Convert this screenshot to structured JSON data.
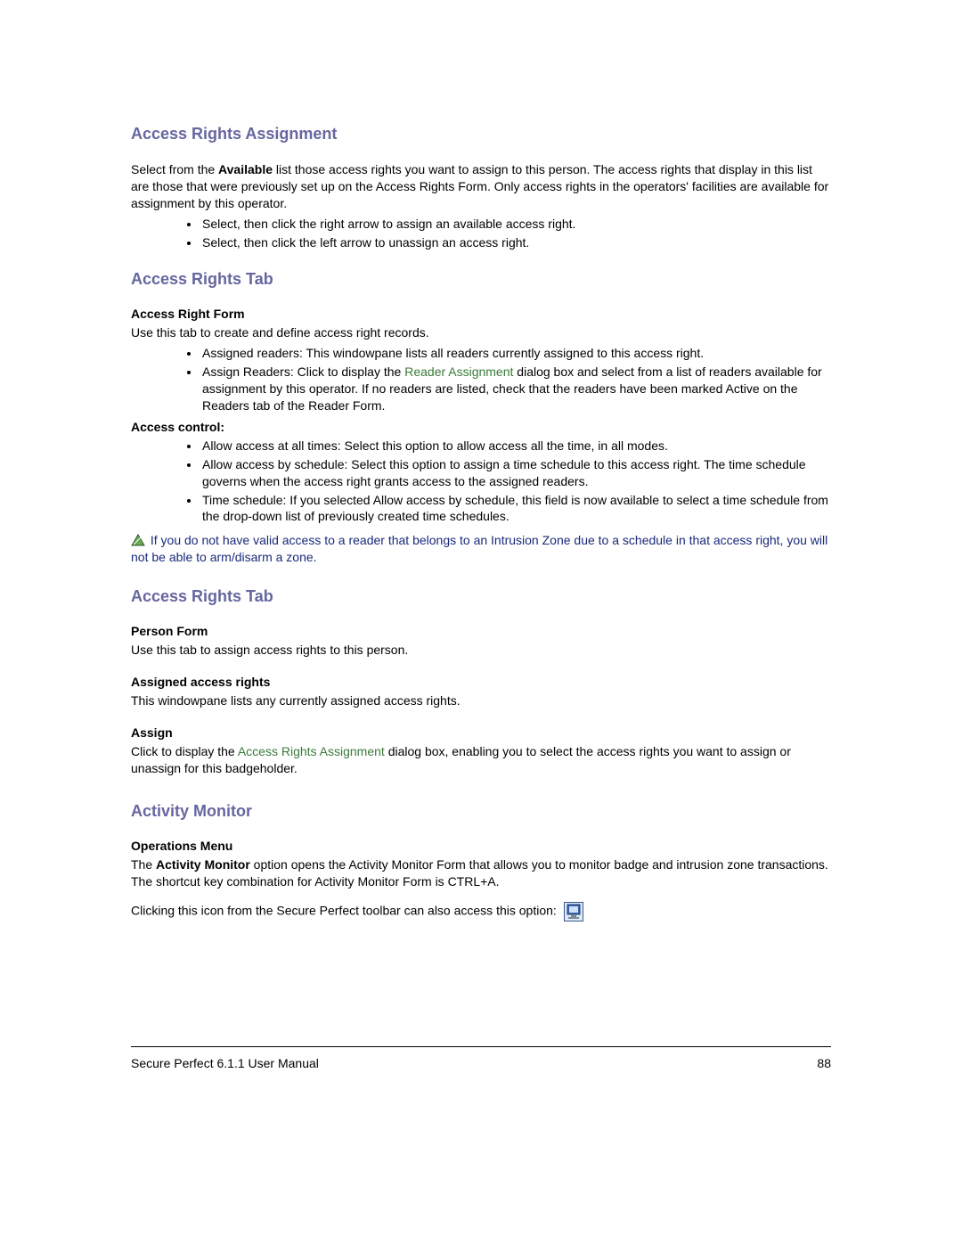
{
  "section1": {
    "heading": "Access Rights Assignment",
    "intro_pre": "Select from the ",
    "intro_bold": "Available",
    "intro_post": " list those access rights you want to assign to this person. The access rights that display in this list are those that were previously set up on the Access Rights Form. Only access rights in the operators' facilities are available for assignment by this operator.",
    "bullets": [
      "Select, then click the right arrow to assign an available access right.",
      "Select, then click the left arrow to unassign an access right."
    ]
  },
  "section2": {
    "heading": "Access Rights Tab",
    "sub1": "Access Right Form",
    "para1": "Use this tab to create and define access right records.",
    "b2a": "Assigned readers: This windowpane lists all readers currently assigned to this access right.",
    "b2b_pre": "Assign Readers: Click to display the ",
    "b2b_link": "Reader Assignment",
    "b2b_post": " dialog box and select from a list of readers available for assignment by this operator. If no readers are listed, check that the readers have been marked Active on the Readers tab of the Reader Form.",
    "sub2": "Access control",
    "bullets3": [
      "Allow access at all times: Select this option to allow access all the time, in all modes.",
      "Allow access by schedule: Select this option to assign a time schedule to this access right. The time schedule governs when the access right grants access to the assigned readers.",
      "Time schedule: If you selected Allow access by schedule, this field is now available to select a time schedule from the drop-down list of previously created time schedules."
    ],
    "note": "If you do not have valid access to a reader that belongs to an Intrusion Zone due to a schedule in that access right, you will not be able to arm/disarm a zone."
  },
  "section3": {
    "heading": "Access Rights Tab",
    "sub1": "Person Form",
    "para1": "Use this tab to assign access rights to this person.",
    "sub2": "Assigned access rights",
    "para2": "This windowpane lists any currently assigned access rights.",
    "sub3": "Assign",
    "para3_pre": "Click to display the ",
    "para3_link": "Access Rights Assignment",
    "para3_post": " dialog box, enabling you to select the access rights you want to assign or unassign for this badgeholder."
  },
  "section4": {
    "heading": "Activity Monitor",
    "sub1": "Operations Menu",
    "para1_pre": "The ",
    "para1_bold": "Activity Monitor",
    "para1_post": " option opens the Activity Monitor Form that allows you to monitor badge and intrusion zone transactions. The shortcut key combination for Activity Monitor Form is CTRL+A.",
    "para2": "Clicking this icon from the Secure Perfect toolbar can also access this option:"
  },
  "footer": {
    "left": "Secure Perfect 6.1.1 User Manual",
    "right": "88"
  }
}
